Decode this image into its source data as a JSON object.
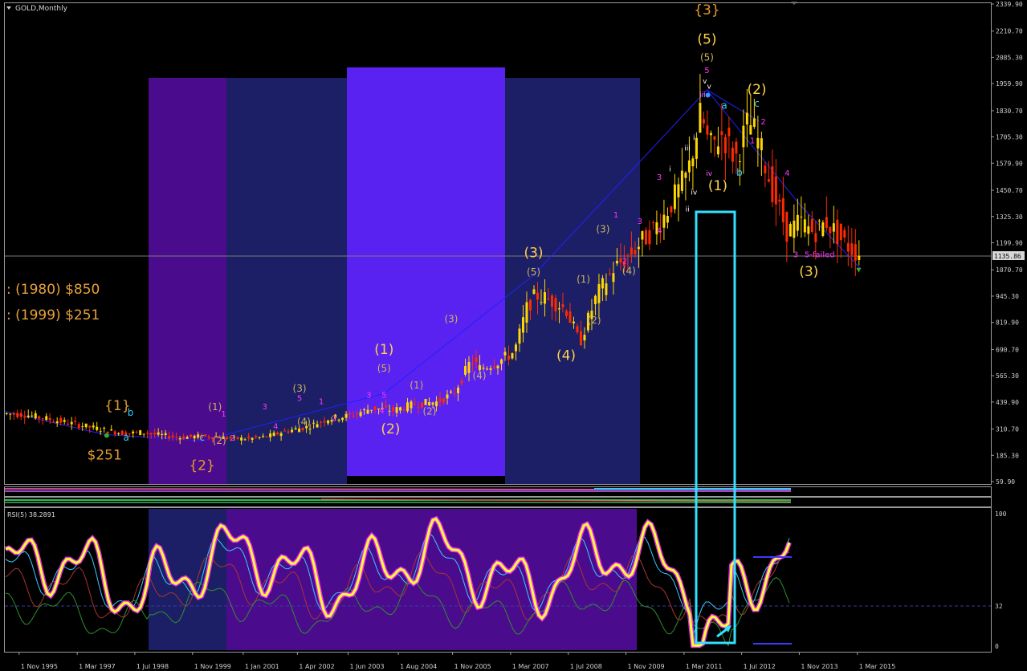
{
  "window": {
    "title": "GOLD,Monthly"
  },
  "colors": {
    "background": "#000000",
    "bull_candle": "#ffd700",
    "bear_candle": "#ff2a00",
    "wave_minor": "#ff33ff",
    "wave_intermediate": "#ffd24a",
    "wave_cyan": "#33ccff",
    "trend_line": "#2020ff",
    "highlight_box": "#33e0ff",
    "rsi_line": "#ffff33",
    "rsi_glow": "#ff33ff",
    "zone_purple": "#4a0c8c",
    "zone_navy": "#1c1f66",
    "zone_blue": "#5a22f0"
  },
  "history_notes": [
    ": (1980) $850",
    ": (1999) $251"
  ],
  "price_panel": {
    "current_price_label": "1135.86",
    "wave_labels": [
      {
        "text": "{3}",
        "group": "major",
        "price": 2290,
        "date": 2011.7
      },
      {
        "text": "(5)",
        "group": "inter",
        "price": 2150,
        "date": 2011.7
      },
      {
        "text": "(5)",
        "group": "minor_y",
        "price": 2070,
        "date": 2011.7
      },
      {
        "text": "5",
        "group": "minor_m",
        "price": 2010,
        "date": 2011.7
      },
      {
        "text": "v",
        "group": "minute_w",
        "price": 1960,
        "date": 2011.65
      },
      {
        "text": "v",
        "group": "minute_w",
        "price": 1935,
        "date": 2011.75
      },
      {
        "text": "iii",
        "group": "minute_r",
        "price": 1895,
        "date": 2011.6
      },
      {
        "text": "a",
        "group": "cyan",
        "price": 1840,
        "date": 2012.1
      },
      {
        "text": "(2)",
        "group": "inter",
        "price": 1910,
        "date": 2012.85
      },
      {
        "text": "c",
        "group": "cyan",
        "price": 1850,
        "date": 2012.85
      },
      {
        "text": "2",
        "group": "minor_m",
        "price": 1765,
        "date": 2013.0
      },
      {
        "text": "1",
        "group": "minor_m",
        "price": 1675,
        "date": 2012.75
      },
      {
        "text": "b",
        "group": "cyan",
        "price": 1520,
        "date": 2012.45
      },
      {
        "text": "(1)",
        "group": "inter",
        "price": 1450,
        "date": 2011.95
      },
      {
        "text": "iv",
        "group": "minute_r",
        "price": 1520,
        "date": 2011.75
      },
      {
        "text": "iv",
        "group": "minute_w",
        "price": 1430,
        "date": 2011.4
      },
      {
        "text": "iii",
        "group": "minute_w",
        "price": 1640,
        "date": 2011.25
      },
      {
        "text": "i",
        "group": "minute_w",
        "price": 1690,
        "date": 2011.4
      },
      {
        "text": "i",
        "group": "minute_w",
        "price": 1540,
        "date": 2010.85
      },
      {
        "text": "ii",
        "group": "minute_w",
        "price": 1350,
        "date": 2011.25
      },
      {
        "text": "3",
        "group": "minor_m",
        "price": 1500,
        "date": 2010.6
      },
      {
        "text": "4",
        "group": "minor_m",
        "price": 1245,
        "date": 2010.6
      },
      {
        "text": "4",
        "group": "minor_m",
        "price": 1520,
        "date": 2013.55
      },
      {
        "text": "3",
        "group": "minor_m",
        "price": 1130,
        "date": 2013.75
      },
      {
        "text": "5-failed",
        "group": "minor_m",
        "price": 1130,
        "date": 2014.3
      },
      {
        "text": "(3)",
        "group": "inter",
        "price": 1040,
        "date": 2014.05
      },
      {
        "text": "(3)",
        "group": "minor_y",
        "price": 1250,
        "date": 2009.3
      },
      {
        "text": "1",
        "group": "minor_m",
        "price": 1320,
        "date": 2009.6
      },
      {
        "text": "2",
        "group": "minor_m",
        "price": 1100,
        "date": 2009.8
      },
      {
        "text": "3",
        "group": "minor_m",
        "price": 1290,
        "date": 2010.15
      },
      {
        "text": "(4)",
        "group": "minor_y",
        "price": 1050,
        "date": 2009.9
      },
      {
        "text": "(3)",
        "group": "inter",
        "price": 1130,
        "date": 2007.7
      },
      {
        "text": "(5)",
        "group": "minor_y",
        "price": 1045,
        "date": 2007.7
      },
      {
        "text": "(1)",
        "group": "minor_y",
        "price": 1010,
        "date": 2008.85
      },
      {
        "text": "(2)",
        "group": "minor_y",
        "price": 815,
        "date": 2009.1
      },
      {
        "text": "(4)",
        "group": "inter",
        "price": 640,
        "date": 2008.45
      },
      {
        "text": "(3)",
        "group": "minor_y",
        "price": 820,
        "date": 2005.8
      },
      {
        "text": "(4)",
        "group": "minor_y",
        "price": 550,
        "date": 2006.45
      },
      {
        "text": "(1)",
        "group": "inter",
        "price": 670,
        "date": 2004.25
      },
      {
        "text": "(5)",
        "group": "minor_y",
        "price": 585,
        "date": 2004.25
      },
      {
        "text": "(1)",
        "group": "minor_y",
        "price": 505,
        "date": 2005.0
      },
      {
        "text": "(2)",
        "group": "minor_y",
        "price": 380,
        "date": 2005.3
      },
      {
        "text": "5",
        "group": "minor_m",
        "price": 460,
        "date": 2004.25
      },
      {
        "text": "4",
        "group": "minor_m",
        "price": 385,
        "date": 2004.2
      },
      {
        "text": "3",
        "group": "minor_m",
        "price": 460,
        "date": 2003.9
      },
      {
        "text": "(2)",
        "group": "inter",
        "price": 290,
        "date": 2004.4
      },
      {
        "text": "(3)",
        "group": "minor_y",
        "price": 490,
        "date": 2002.3
      },
      {
        "text": "5",
        "group": "minor_m",
        "price": 445,
        "date": 2002.3
      },
      {
        "text": "1",
        "group": "minor_m",
        "price": 430,
        "date": 2002.8
      },
      {
        "text": "2",
        "group": "minor_m",
        "price": 350,
        "date": 2003.1
      },
      {
        "text": "(4)",
        "group": "minor_y",
        "price": 330,
        "date": 2002.4
      },
      {
        "text": "4",
        "group": "minor_m",
        "price": 310,
        "date": 2001.75
      },
      {
        "text": "3",
        "group": "minor_m",
        "price": 405,
        "date": 2001.5
      },
      {
        "text": "1",
        "group": "minor_m",
        "price": 370,
        "date": 2000.55
      },
      {
        "text": "(1)",
        "group": "minor_y",
        "price": 400,
        "date": 2000.35
      },
      {
        "text": "(2)",
        "group": "minor_y",
        "price": 240,
        "date": 2000.45
      },
      {
        "text": "2",
        "group": "minor_m",
        "price": 255,
        "date": 2000.75
      },
      {
        "text": "c",
        "group": "cyan",
        "price": 255,
        "date": 2000.05
      },
      {
        "text": "{2}",
        "group": "major",
        "price": 115,
        "date": 2000.05
      },
      {
        "text": "{1}",
        "group": "major",
        "price": 400,
        "date": 1998.1
      },
      {
        "text": "b",
        "group": "cyan",
        "price": 375,
        "date": 1998.4
      },
      {
        "text": "a",
        "group": "cyan",
        "price": 255,
        "date": 1998.3
      },
      {
        "text": "$251",
        "group": "major",
        "price": 165,
        "date": 1997.8
      }
    ]
  },
  "rsi_panel": {
    "label": "RSI(5) 38.2891",
    "levels": [
      "100",
      "32",
      "0"
    ],
    "value": 38.2891
  },
  "chart_data": {
    "type": "line",
    "title": "GOLD,Monthly",
    "xlabel": "",
    "ylabel": "",
    "x_tick_labels": [
      "1 Nov 1995",
      "1 Mar 1997",
      "1 Jul 1998",
      "1 Nov 1999",
      "1 Jan 2001",
      "1 Apr 2002",
      "1 Jun 2003",
      "1 Aug 2004",
      "1 Nov 2005",
      "1 Mar 2007",
      "1 Jul 2008",
      "1 Nov 2009",
      "1 Mar 2011",
      "1 Jul 2012",
      "1 Nov 2013",
      "1 Mar 2015"
    ],
    "x_tick_dates": [
      1995.83,
      1997.17,
      1998.5,
      1999.83,
      2001.0,
      2002.25,
      2003.42,
      2004.58,
      2005.83,
      2007.17,
      2008.5,
      2009.83,
      2011.17,
      2012.5,
      2013.83,
      2015.17
    ],
    "y_tick_labels": [
      "2339.90",
      "2210.70",
      "2085.30",
      "1959.90",
      "1830.70",
      "1705.30",
      "1579.90",
      "1450.70",
      "1325.30",
      "1199.90",
      "1070.70",
      "945.30",
      "819.90",
      "690.70",
      "565.30",
      "439.90",
      "310.70",
      "185.30",
      "59.90"
    ],
    "ylim": [
      59.9,
      2339.9
    ],
    "xlim": [
      1995.5,
      2018.25
    ],
    "grid": false,
    "series": [
      {
        "x": [
          1995.5,
          1996.0,
          1996.5,
          1997.0,
          1997.5,
          1998.0,
          1998.3,
          1998.7,
          1999.0,
          1999.6,
          1999.9,
          2000.4,
          2000.8,
          2001.2,
          2001.6,
          2002.0,
          2002.5,
          2003.0,
          2003.5,
          2004.0,
          2004.5,
          2005.0,
          2005.5,
          2005.9,
          2006.3,
          2006.5,
          2006.9,
          2007.3,
          2007.6,
          2007.8,
          2008.2,
          2008.5,
          2008.8,
          2009.2,
          2009.6,
          2009.9,
          2010.3,
          2010.7,
          2011.0,
          2011.3,
          2011.6,
          2011.8,
          2012.1,
          2012.4,
          2012.7,
          2012.9,
          2013.3,
          2013.6,
          2013.9,
          2014.2,
          2014.5,
          2014.9,
          2015.2
        ],
        "y": [
          385,
          380,
          360,
          340,
          320,
          300,
          290,
          295,
          285,
          270,
          275,
          275,
          265,
          265,
          275,
          300,
          320,
          360,
          375,
          410,
          400,
          430,
          440,
          480,
          640,
          600,
          630,
          680,
          900,
          950,
          920,
          880,
          720,
          950,
          1080,
          1130,
          1220,
          1310,
          1420,
          1530,
          1820,
          1650,
          1720,
          1600,
          1780,
          1700,
          1420,
          1250,
          1300,
          1250,
          1300,
          1200,
          1150
        ]
      }
    ]
  }
}
